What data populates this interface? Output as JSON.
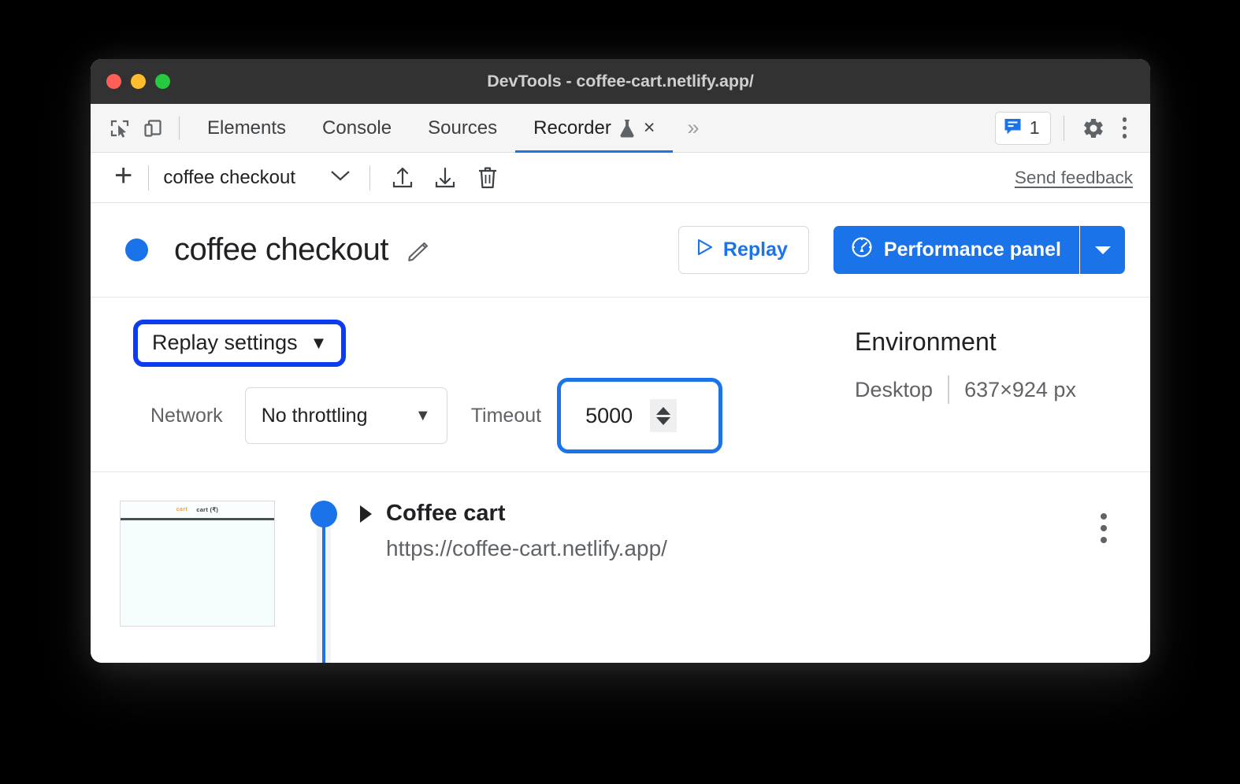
{
  "window": {
    "title": "DevTools - coffee-cart.netlify.app/",
    "traffic_lights": [
      "close-red",
      "minimize-yellow",
      "maximize-green"
    ]
  },
  "tabbar": {
    "inspect_icon": "inspect-element-icon",
    "device_icon": "device-toolbar-icon",
    "tabs": [
      {
        "label": "Elements",
        "active": false
      },
      {
        "label": "Console",
        "active": false
      },
      {
        "label": "Sources",
        "active": false
      },
      {
        "label": "Recorder",
        "active": true,
        "experiment_icon": "flask-icon",
        "close": "×"
      }
    ],
    "more_tabs": "»",
    "issues": {
      "icon": "issues-message-icon",
      "count": "1"
    },
    "settings_icon": "gear-icon",
    "menu_icon": "kebab-menu-icon"
  },
  "recorder_toolbar": {
    "add_label": "+",
    "recording_name": "coffee checkout",
    "select_caret": "chevron-down-icon",
    "export_icon": "export-upload-icon",
    "import_icon": "import-download-icon",
    "delete_icon": "trash-icon",
    "feedback_label": "Send feedback"
  },
  "recording_header": {
    "status_dot_color": "#1a73e8",
    "title": "coffee checkout",
    "edit_icon": "pencil-icon",
    "replay_label": "Replay",
    "replay_icon": "play-triangle-icon",
    "performance_label": "Performance panel",
    "performance_icon": "performance-gauge-icon",
    "performance_caret": "chevron-down-icon"
  },
  "settings": {
    "replay_settings_label": "Replay settings",
    "replay_settings_caret": "▼",
    "network_label": "Network",
    "network_value": "No throttling",
    "network_caret": "▼",
    "timeout_label": "Timeout",
    "timeout_value": "5000",
    "focus_ring_color": "#0d3cf0",
    "timeout_ring_color": "#1a73e8",
    "environment": {
      "title": "Environment",
      "device": "Desktop",
      "viewport": "637×924 px"
    }
  },
  "steps": [
    {
      "title": "Coffee cart",
      "url": "https://coffee-cart.netlify.app/",
      "caret": "expand-triangle-icon",
      "menu_icon": "kebab-menu-icon",
      "thumbnail": {
        "logo": "cart",
        "nav": "cart (₹)"
      }
    }
  ]
}
